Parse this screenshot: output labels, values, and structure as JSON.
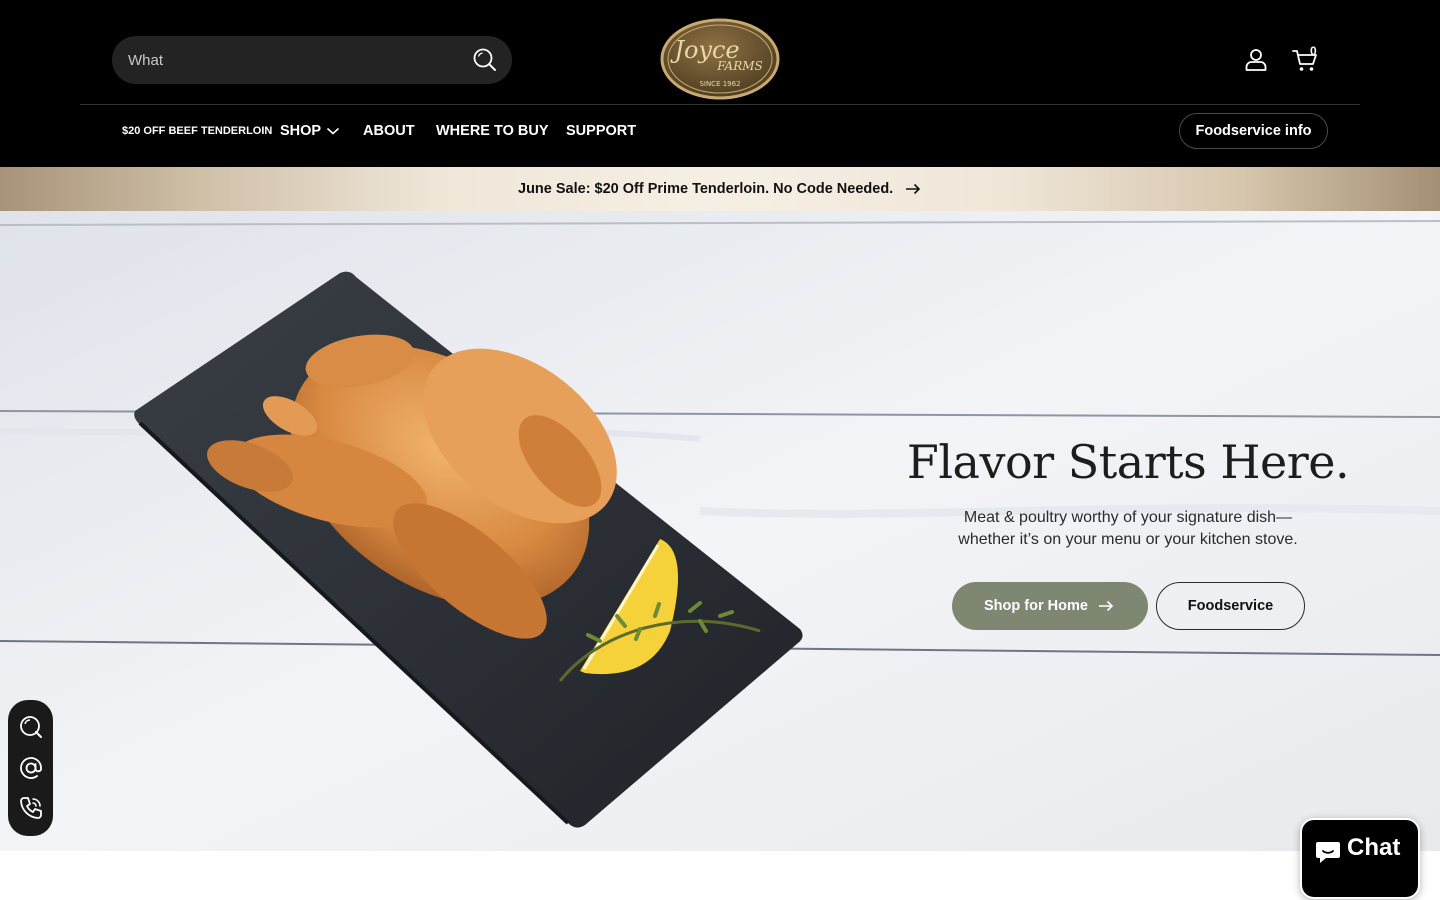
{
  "header": {
    "search": {
      "value": "What",
      "placeholder": ""
    },
    "logo": {
      "brand": "Joyce Farms",
      "tagline": "SINCE 1962",
      "color": "#c9a96e"
    },
    "cart": {
      "count": "0"
    }
  },
  "nav": {
    "promo_link": "$20 OFF BEEF TENDERLOIN",
    "items": [
      "SHOP",
      "ABOUT",
      "WHERE TO BUY",
      "SUPPORT"
    ],
    "foodservice_info": "Foodservice info"
  },
  "promo_bar": {
    "text": "June Sale: $20 Off Prime Tenderloin. No Code Needed."
  },
  "hero": {
    "title": "Flavor Starts Here.",
    "subtitle_line1": "Meat & poultry worthy of your signature dish—",
    "subtitle_line2": "whether it’s on your menu or your kitchen stove.",
    "primary_button": "Shop for Home",
    "secondary_button": "Foodservice",
    "accent_color": "#7d8772"
  },
  "side_contact": {
    "icons": [
      "chat-icon",
      "email-icon",
      "phone-icon"
    ]
  },
  "chat": {
    "label": "Chat"
  }
}
